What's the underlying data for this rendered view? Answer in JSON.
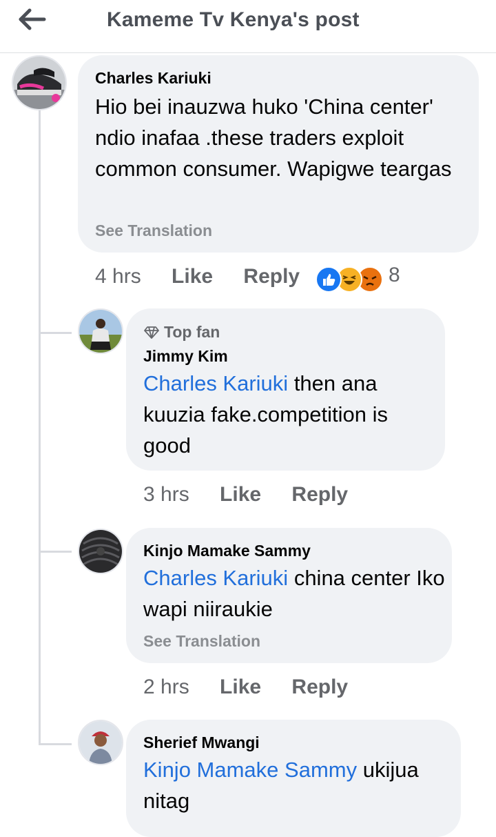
{
  "header": {
    "title": "Kameme Tv Kenya's post"
  },
  "comments": [
    {
      "author": "Charles Kariuki",
      "text": "Hio bei inauzwa huko 'China center' ndio inafaa .these traders exploit common consumer. Wapigwe teargas",
      "see_translation": "See Translation",
      "time": "4 hrs",
      "like": "Like",
      "reply": "Reply",
      "reactions": {
        "types": [
          "like",
          "haha",
          "angry"
        ],
        "count": "8"
      }
    }
  ],
  "replies": [
    {
      "badge": "Top fan",
      "author": "Jimmy Kim",
      "mention": "Charles Kariuki",
      "text": " then ana kuuzia   fake.competition is good",
      "time": "3 hrs",
      "like": "Like",
      "reply": "Reply"
    },
    {
      "author": "Kinjo Mamake Sammy",
      "mention": "Charles Kariuki",
      "text": " china center Iko wapi niiraukie",
      "see_translation": "See Translation",
      "time": "2 hrs",
      "like": "Like",
      "reply": "Reply"
    },
    {
      "author": "Sherief Mwangi",
      "mention": "Kinjo Mamake Sammy",
      "text": " ukijua nitag"
    }
  ],
  "colors": {
    "mention": "#216fdb",
    "bubble": "#f0f2f5",
    "like": "#1877f2",
    "haha": "#f7b125",
    "angry": "#e9710f"
  }
}
